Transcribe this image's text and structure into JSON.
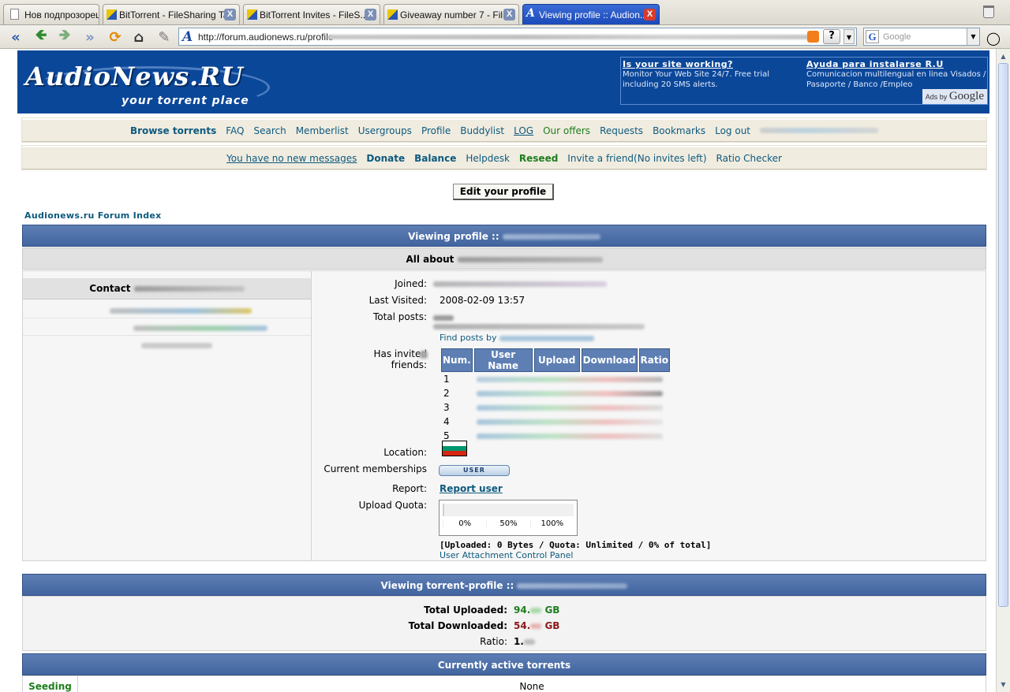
{
  "browser": {
    "tabs": [
      {
        "label": "Нов подпрозорец"
      },
      {
        "label": "BitTorrent - FileSharing Talk"
      },
      {
        "label": "BitTorrent Invites - FileS..."
      },
      {
        "label": "Giveaway number 7 - Fil..."
      },
      {
        "label": "Viewing profile :: Audion..."
      }
    ],
    "url": "http://forum.audionews.ru/profile",
    "search_placeholder": "Google",
    "close_glyph": "X"
  },
  "site": {
    "logo_title": "AudioNews.RU",
    "logo_tagline": "your torrent place",
    "ads": [
      {
        "title": "Is your site working?",
        "text": "Monitor Your Web Site 24/7. Free trial including 20 SMS alerts."
      },
      {
        "title": "Ayuda para instalarse R.U",
        "text": "Comunicacion multilengual en linea Visados / Pasaporte / Banco /Empleo"
      }
    ],
    "ads_by": "Ads by",
    "ads_brand": "Google"
  },
  "menu1": [
    "Browse torrents",
    "FAQ",
    "Search",
    "Memberlist",
    "Usergroups",
    "Profile",
    "Buddylist",
    "LOG",
    "Our offers",
    "Requests",
    "Bookmarks",
    "Log out"
  ],
  "menu2": [
    "You have no new messages",
    "Donate",
    "Balance",
    "Helpdesk",
    "Reseed",
    "Invite a friend(No invites left)",
    "Ratio Checker"
  ],
  "profile": {
    "edit_button": "Edit your profile",
    "forum_index": "Audionews.ru Forum Index",
    "viewing_title": "Viewing profile ::",
    "all_about": "All about",
    "contact": "Contact",
    "joined_label": "Joined:",
    "last_visited_label": "Last Visited:",
    "last_visited_value": "2008-02-09 13:57",
    "total_posts_label": "Total posts:",
    "find_posts": "Find posts by",
    "invited_label_1": "Has invited",
    "invited_label_2": "friends:",
    "friends_headers": [
      "Num.",
      "User Name",
      "Upload",
      "Download",
      "Ratio"
    ],
    "friends_rows": [
      "1",
      "2",
      "3",
      "4",
      "5"
    ],
    "location_label": "Location:",
    "memberships_label": "Current memberships",
    "membership_badge": "USER",
    "report_label": "Report:",
    "report_link": "Report user",
    "quota_label": "Upload Quota:",
    "quota_ticks": [
      "0%",
      "50%",
      "100%"
    ],
    "quota_fill": 0,
    "quota_summary": "[Uploaded: 0 Bytes / Quota: Unlimited / 0% of total]",
    "attachment_panel": "User Attachment Control Panel"
  },
  "torrent_profile": {
    "title": "Viewing torrent-profile ::",
    "uploaded_label": "Total Uploaded:",
    "uploaded_value": "94.",
    "uploaded_unit": "GB",
    "downloaded_label": "Total Downloaded:",
    "downloaded_value": "54.",
    "downloaded_unit": "GB",
    "ratio_label": "Ratio:",
    "ratio_value": "1.",
    "active_title": "Currently active torrents",
    "seeding_label": "Seeding",
    "none_label": "None"
  },
  "colors": {
    "header_blue": "#0b4799",
    "bar_blue": "#42659f",
    "link": "#0e5a7e",
    "green": "#1e7e1e",
    "red": "#8b1a1a",
    "flag": [
      "#ffffff",
      "#00966e",
      "#d62612"
    ]
  }
}
